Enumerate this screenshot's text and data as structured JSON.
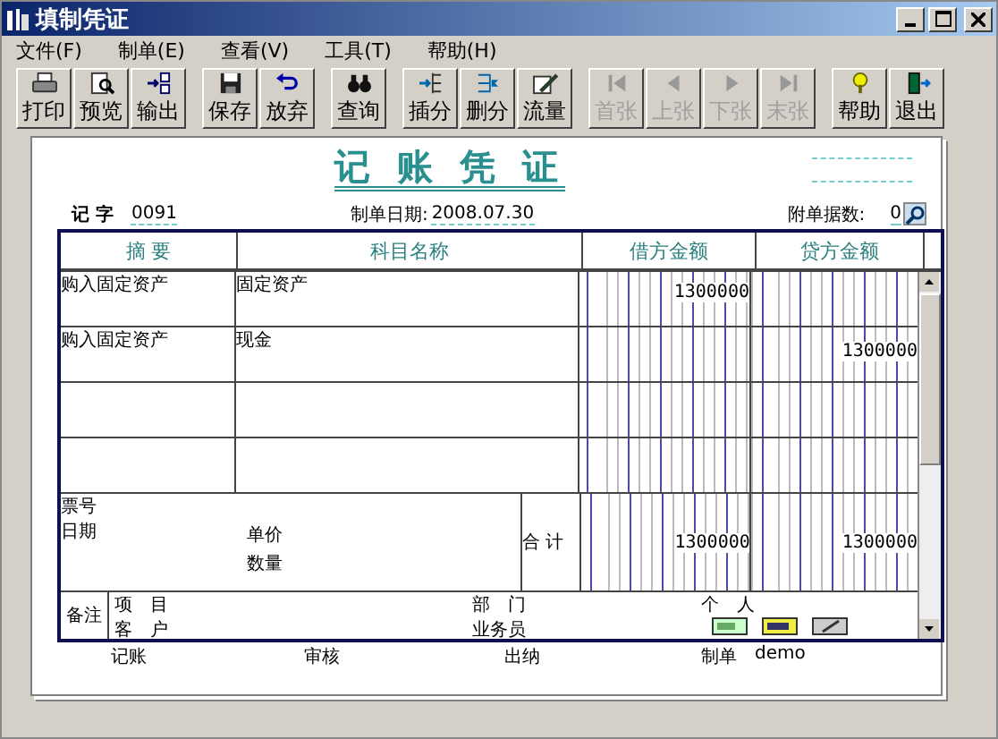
{
  "window": {
    "title": "填制凭证"
  },
  "menu": [
    "文件(F)",
    "制单(E)",
    "查看(V)",
    "工具(T)",
    "帮助(H)"
  ],
  "toolbar": [
    [
      {
        "label": "打印",
        "kind": "print",
        "disabled": false
      },
      {
        "label": "预览",
        "kind": "preview",
        "disabled": false
      },
      {
        "label": "输出",
        "kind": "export",
        "disabled": false
      }
    ],
    [
      {
        "label": "保存",
        "kind": "save",
        "disabled": false
      },
      {
        "label": "放弃",
        "kind": "undo",
        "disabled": false
      }
    ],
    [
      {
        "label": "查询",
        "kind": "find",
        "disabled": false
      }
    ],
    [
      {
        "label": "插分",
        "kind": "insert",
        "disabled": false
      },
      {
        "label": "删分",
        "kind": "delete",
        "disabled": false
      },
      {
        "label": "流量",
        "kind": "edit",
        "disabled": false
      }
    ],
    [
      {
        "label": "首张",
        "kind": "first",
        "disabled": true
      },
      {
        "label": "上张",
        "kind": "prev",
        "disabled": true
      },
      {
        "label": "下张",
        "kind": "next",
        "disabled": true
      },
      {
        "label": "末张",
        "kind": "last",
        "disabled": true
      }
    ],
    [
      {
        "label": "帮助",
        "kind": "help",
        "disabled": false
      },
      {
        "label": "退出",
        "kind": "exit",
        "disabled": false
      }
    ]
  ],
  "voucher": {
    "title": "记 账 凭 证",
    "type_label": "记 字",
    "number": "0091",
    "date_label": "制单日期:",
    "date": "2008.07.30",
    "attachments_label": "附单据数:",
    "attachments": "0",
    "columns": [
      "摘 要",
      "科目名称",
      "借方金额",
      "贷方金额"
    ],
    "rows": [
      {
        "summary": "购入固定资产",
        "account": "固定资产",
        "debit": "1300000"
      },
      {
        "summary": "购入固定资产",
        "account": "现金",
        "credit": "1300000"
      },
      {},
      {}
    ],
    "info": {
      "ticket_no": "票号",
      "date": "日期",
      "unit_price": "单价",
      "quantity": "数量",
      "total_label": "合 计",
      "debit_total": "1300000",
      "credit_total": "1300000"
    },
    "notes": {
      "label": "备注",
      "project": "项　目",
      "customer": "客　户",
      "department": "部　门",
      "salesperson": "业务员",
      "person": "个　人"
    },
    "signatures": [
      {
        "label": "记账"
      },
      {
        "label": "审核"
      },
      {
        "label": "出纳"
      },
      {
        "label": "制单",
        "value": "demo"
      }
    ]
  }
}
